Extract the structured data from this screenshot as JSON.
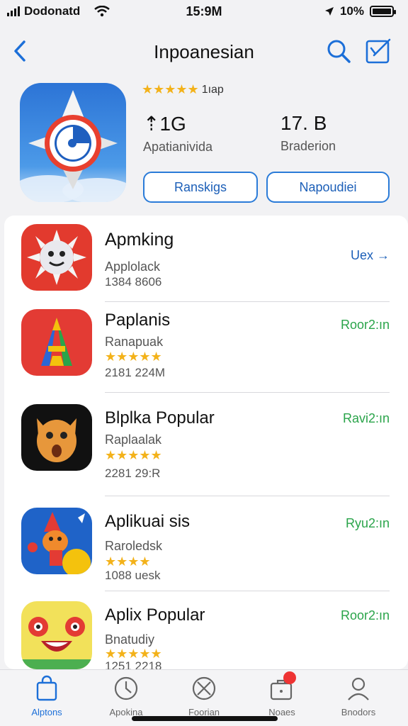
{
  "status": {
    "carrier": "Dodonatd",
    "time": "15:9M",
    "battery": "10%"
  },
  "nav": {
    "title": "Inpoanesian"
  },
  "hero": {
    "rating_stars": "★★★★★",
    "rating_text": "1ıap",
    "stat1_value": "⇡1G",
    "stat1_label": "Apatianivida",
    "stat2_value": "17. B",
    "stat2_label": "Braderion",
    "button1": "Ranskigs",
    "button2": "Napoudiei"
  },
  "apps": [
    {
      "name": "Apmking",
      "subtitle": "Applolack",
      "meta": "1384 8606",
      "action": "Uex →",
      "action_color": "#1c5fb8"
    },
    {
      "name": "Paplanis",
      "subtitle": "Ranapuak",
      "stars": "★★★★★",
      "meta": "2181 224M",
      "action": "Roor2:ın",
      "action_color": "#2aa44a"
    },
    {
      "name": "Blplka Popular",
      "subtitle": "Raplaalak",
      "stars": "★★★★★",
      "meta": "2281 29:R",
      "action": "Ravi2:ın",
      "action_color": "#2aa44a"
    },
    {
      "name": "Aplikuai sis",
      "subtitle": "Raroledsk",
      "stars": "★★★★",
      "meta": "1088 uesk",
      "action": "Ryu2:ın",
      "action_color": "#2aa44a"
    },
    {
      "name": "Aplix Popular",
      "subtitle": "Bnatudiy",
      "stars": "★★★★★",
      "meta": "1251 2218",
      "action": "Roor2:ın",
      "action_color": "#2aa44a"
    }
  ],
  "tabs": [
    {
      "label": "Alptons"
    },
    {
      "label": "Apokina"
    },
    {
      "label": "Foorian"
    },
    {
      "label": "Noaes"
    },
    {
      "label": "Bnodors"
    }
  ]
}
